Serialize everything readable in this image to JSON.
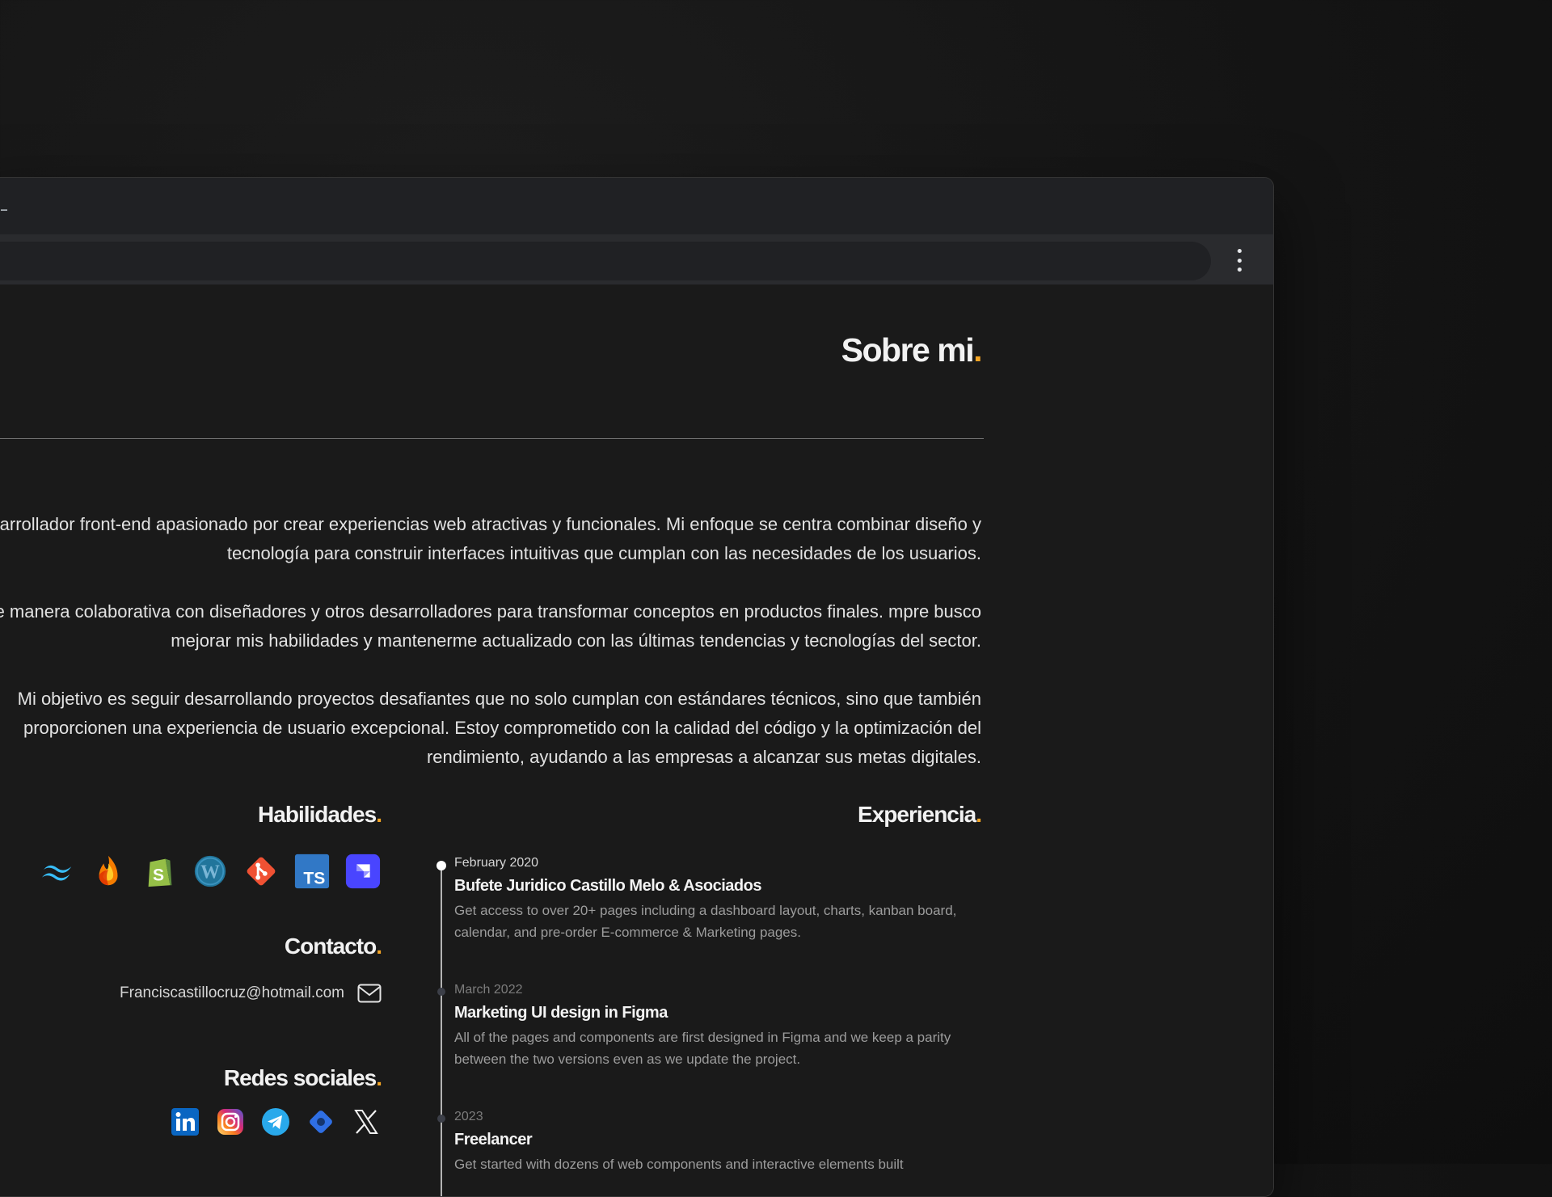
{
  "window": {
    "menu_icon": "kebab-menu-icon"
  },
  "about": {
    "title": "Sobre mi",
    "title_dot": ".",
    "paragraphs": [
      "y un desarrollador front-end apasionado por crear experiencias web atractivas y funcionales. Mi enfoque se centra combinar diseño y tecnología para construir interfaces intuitivas que cumplan con las necesidades de los usuarios.",
      "de manera colaborativa con diseñadores y otros desarrolladores para transformar conceptos en productos finales. mpre busco mejorar mis habilidades y mantenerme actualizado con las últimas tendencias y tecnologías del sector.",
      "Mi objetivo es seguir desarrollando proyectos desafiantes que no solo cumplan con estándares técnicos, sino que también proporcionen una experiencia de usuario excepcional. Estoy comprometido con la calidad del código y la optimización del rendimiento, ayudando a las empresas a alcanzar sus metas digitales."
    ]
  },
  "skills": {
    "title": "Habilidades",
    "title_dot": ".",
    "icons": [
      "tailwind-icon",
      "firebase-icon",
      "shopify-icon",
      "wordpress-icon",
      "git-icon",
      "typescript-icon",
      "strapi-icon"
    ]
  },
  "contact": {
    "title": "Contacto",
    "title_dot": ".",
    "email": "Franciscastillocruz@hotmail.com",
    "email_icon": "mail-icon"
  },
  "social": {
    "title": "Redes sociales",
    "title_dot": ".",
    "icons": [
      "linkedin-icon",
      "instagram-icon",
      "telegram-icon",
      "diamond-icon",
      "x-icon"
    ]
  },
  "experience": {
    "title": "Experiencia",
    "title_dot": ".",
    "items": [
      {
        "date": "February 2020",
        "title": "Bufete Juridico Castillo Melo & Asociados",
        "description": "Get access to over 20+ pages including a dashboard layout, charts, kanban board, calendar, and pre-order E-commerce & Marketing pages."
      },
      {
        "date": "March 2022",
        "title": "Marketing UI design in Figma",
        "description": "All of the pages and components are first designed in Figma and we keep a parity between the two versions even as we update the project."
      },
      {
        "date": "2023",
        "title": "Freelancer",
        "description": "Get started with dozens of web components and interactive elements built"
      }
    ]
  },
  "colors": {
    "accent": "#f5a524",
    "background": "#1a1a1a",
    "text": "#e9e9e9"
  }
}
